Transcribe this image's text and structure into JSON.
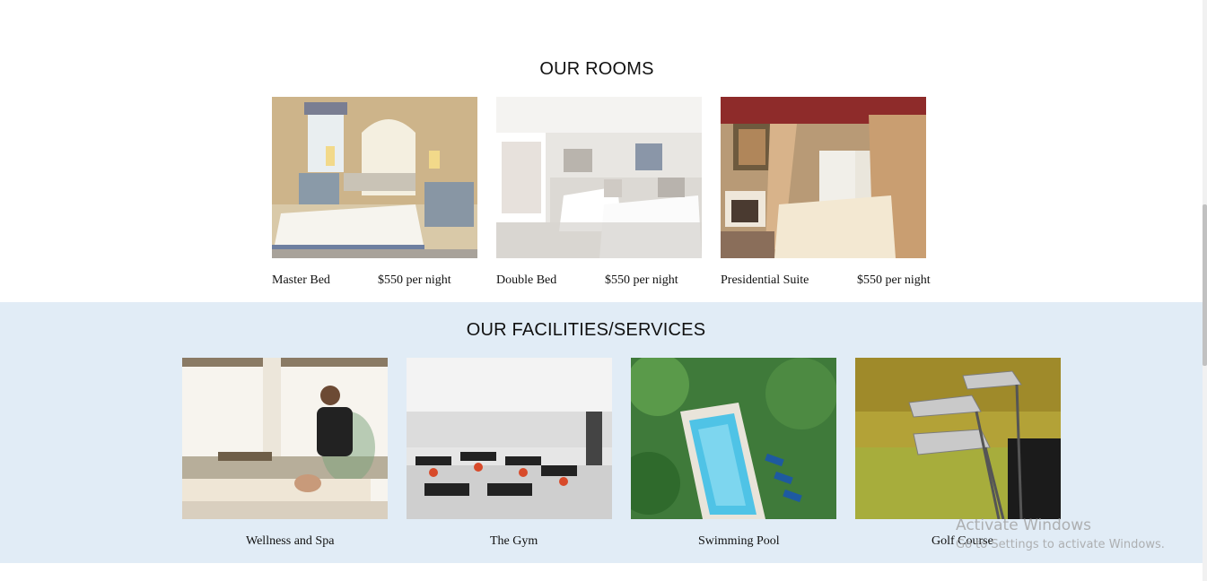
{
  "rooms": {
    "title": "OUR ROOMS",
    "items": [
      {
        "name": "Master Bed",
        "price": "$550 per night"
      },
      {
        "name": "Double Bed",
        "price": "$550 per night"
      },
      {
        "name": "Presidential Suite",
        "price": "$550 per night"
      }
    ]
  },
  "facilities": {
    "title": "OUR FACILITIES/SERVICES",
    "items": [
      {
        "name": "Wellness and Spa"
      },
      {
        "name": "The Gym"
      },
      {
        "name": "Swimming Pool"
      },
      {
        "name": "Golf Course"
      }
    ]
  },
  "watermark": {
    "line1": "Activate Windows",
    "line2": "Go to Settings to activate Windows."
  },
  "colors": {
    "facilities_background": "#e1ecf6",
    "text": "#111111"
  }
}
